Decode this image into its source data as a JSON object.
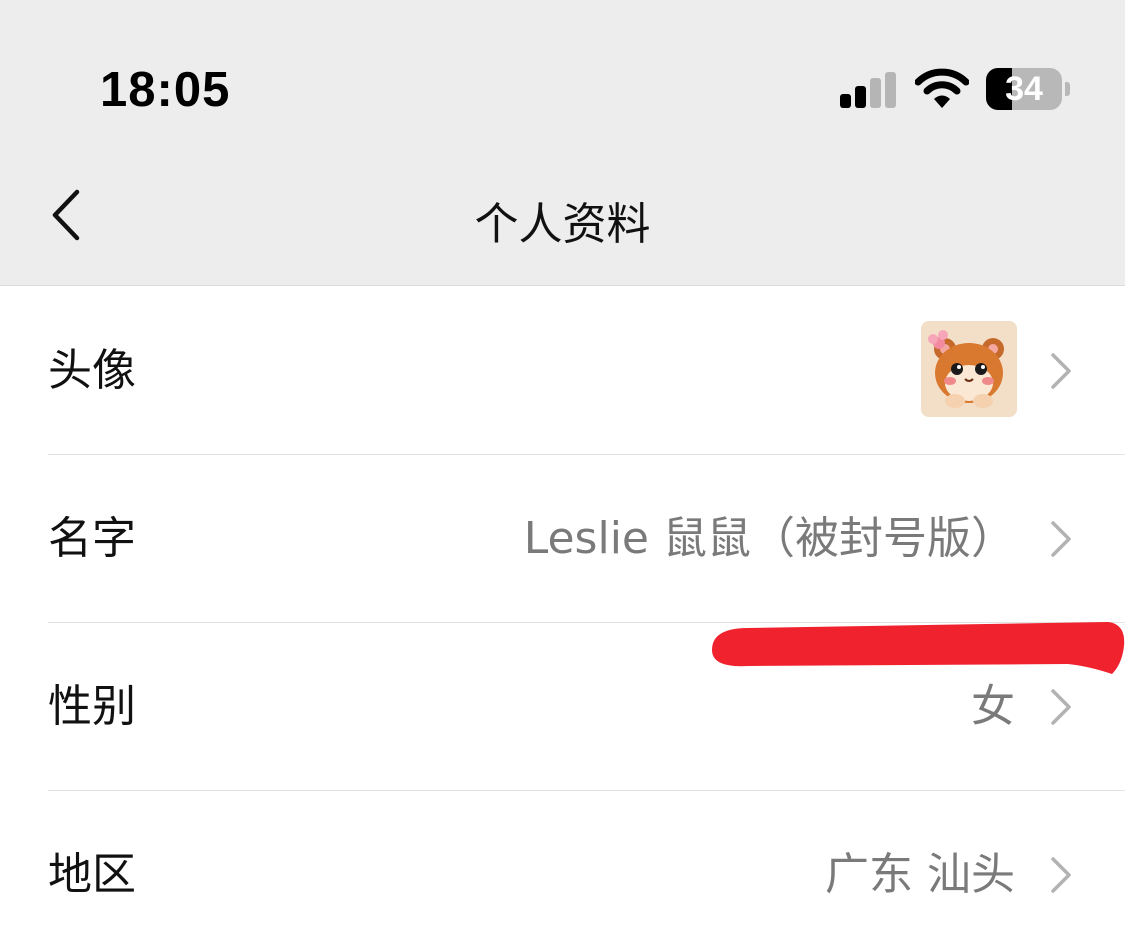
{
  "status_bar": {
    "time": "18:05",
    "battery_level": "34",
    "battery_fraction": 0.34,
    "signal_bars": 2,
    "icons": [
      "cellular-signal-icon",
      "wifi-icon",
      "battery-icon"
    ]
  },
  "nav": {
    "title": "个人资料",
    "back_icon": "chevron-left-icon"
  },
  "rows": [
    {
      "label": "头像",
      "value": "",
      "type": "avatar",
      "avatar_icon": "hamster-avatar-icon"
    },
    {
      "label": "名字",
      "value": "Leslie 鼠鼠（被封号版）"
    },
    {
      "label": "性别",
      "value": "女"
    },
    {
      "label": "地区",
      "value": "广东 汕头"
    }
  ],
  "colors": {
    "bar_background": "#ededed",
    "value_text": "#7a7a7a",
    "chevron": "#b2b2b2",
    "redaction_mark": "#f0222e"
  }
}
